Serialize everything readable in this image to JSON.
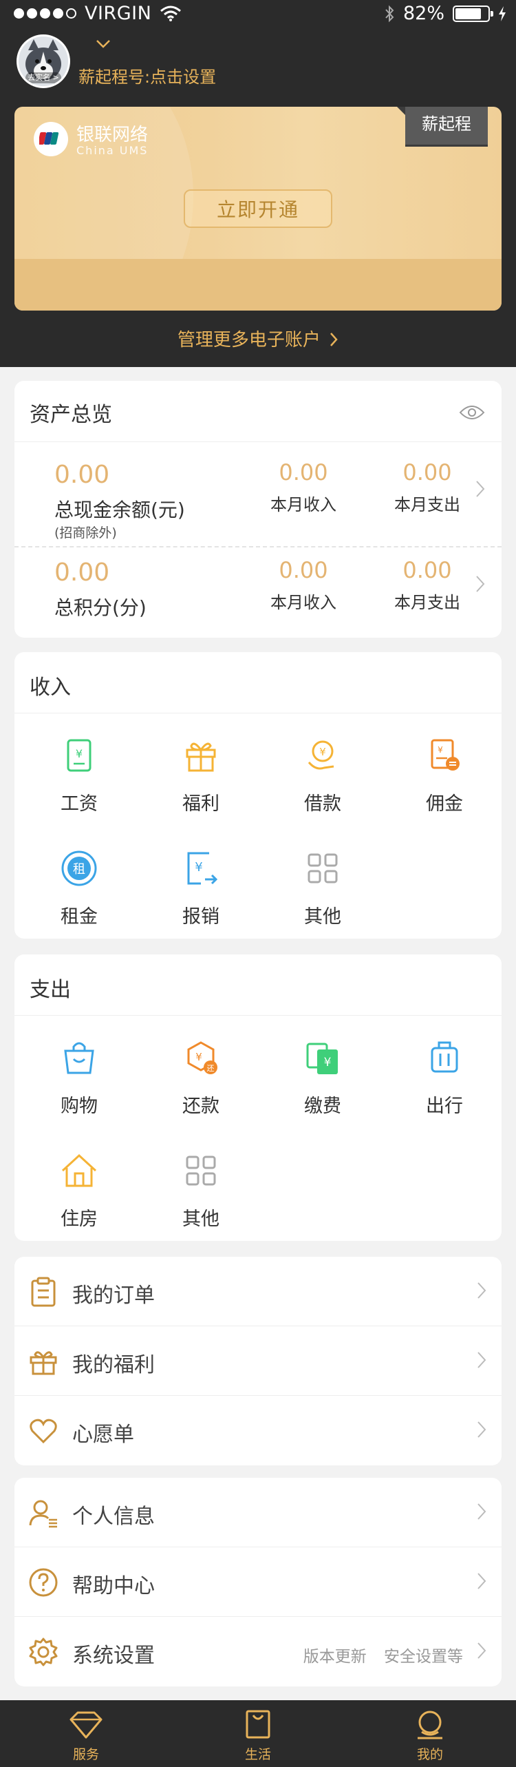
{
  "status_bar": {
    "carrier": "VIRGIN",
    "battery": "82%",
    "battery_level": 0.82
  },
  "profile": {
    "avatar_badge": "去实名 >",
    "xqc_label": "薪起程号:点击设置"
  },
  "card": {
    "brand": "银联网络",
    "brand_en": "China UMS",
    "tag": "薪起程",
    "open_button": "立即开通"
  },
  "manage_link": "管理更多电子账户",
  "assets": {
    "title": "资产总览",
    "cash": {
      "value": "0.00",
      "label": "总现金余额(元)",
      "sublabel": "(招商除外)",
      "income_value": "0.00",
      "income_label": "本月收入",
      "expense_value": "0.00",
      "expense_label": "本月支出"
    },
    "points": {
      "value": "0.00",
      "label": "总积分(分)",
      "income_value": "0.00",
      "income_label": "本月收入",
      "expense_value": "0.00",
      "expense_label": "本月支出"
    }
  },
  "income": {
    "title": "收入",
    "items": [
      {
        "label": "工资",
        "icon": "salary-icon"
      },
      {
        "label": "福利",
        "icon": "gift-icon"
      },
      {
        "label": "借款",
        "icon": "loan-icon"
      },
      {
        "label": "佣金",
        "icon": "commission-icon"
      },
      {
        "label": "租金",
        "icon": "rent-icon"
      },
      {
        "label": "报销",
        "icon": "reimburse-icon"
      },
      {
        "label": "其他",
        "icon": "grid-icon"
      }
    ]
  },
  "expense": {
    "title": "支出",
    "items": [
      {
        "label": "购物",
        "icon": "shopping-bag-icon"
      },
      {
        "label": "还款",
        "icon": "repayment-icon"
      },
      {
        "label": "缴费",
        "icon": "payment-icon"
      },
      {
        "label": "出行",
        "icon": "luggage-icon"
      },
      {
        "label": "住房",
        "icon": "house-icon"
      },
      {
        "label": "其他",
        "icon": "grid-icon"
      }
    ]
  },
  "list1": [
    {
      "label": "我的订单",
      "icon": "clipboard-icon"
    },
    {
      "label": "我的福利",
      "icon": "gift-icon"
    },
    {
      "label": "心愿单",
      "icon": "heart-icon"
    }
  ],
  "list2": [
    {
      "label": "个人信息",
      "icon": "user-icon"
    },
    {
      "label": "帮助中心",
      "icon": "question-icon"
    },
    {
      "label": "系统设置",
      "icon": "gear-icon",
      "hint1": "版本更新",
      "hint2": "安全设置等"
    }
  ],
  "bottom_nav": [
    {
      "label": "服务",
      "icon": "diamond-icon"
    },
    {
      "label": "生活",
      "icon": "bag-icon"
    },
    {
      "label": "我的",
      "icon": "person-icon"
    }
  ],
  "colors": {
    "accent": "#e8b35a",
    "header_bg": "#2b2b2b",
    "value_gold": "#e4b472"
  }
}
